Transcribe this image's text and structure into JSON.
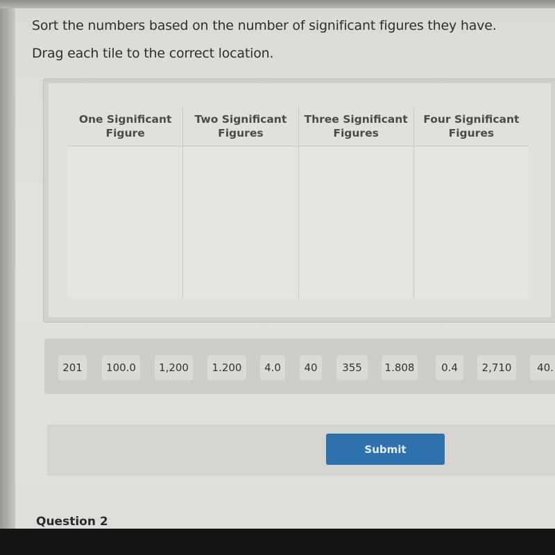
{
  "instructions": {
    "question": "Sort the numbers based on the number of significant figures they have.",
    "directions": "Drag each tile to the correct location."
  },
  "categories": [
    {
      "line1": "One Significant",
      "line2": "Figure"
    },
    {
      "line1": "Two Significant",
      "line2": "Figures"
    },
    {
      "line1": "Three Significant",
      "line2": "Figures"
    },
    {
      "line1": "Four Significant",
      "line2": "Figures"
    }
  ],
  "tiles": [
    "201",
    "100.0",
    "1,200",
    "1.200",
    "4.0",
    "40",
    "355",
    "1.808",
    "0.4",
    "2,710",
    "40."
  ],
  "submit_label": "Submit",
  "next_question_label": "Question 2",
  "colors": {
    "submit_button": "#2d72ad"
  }
}
